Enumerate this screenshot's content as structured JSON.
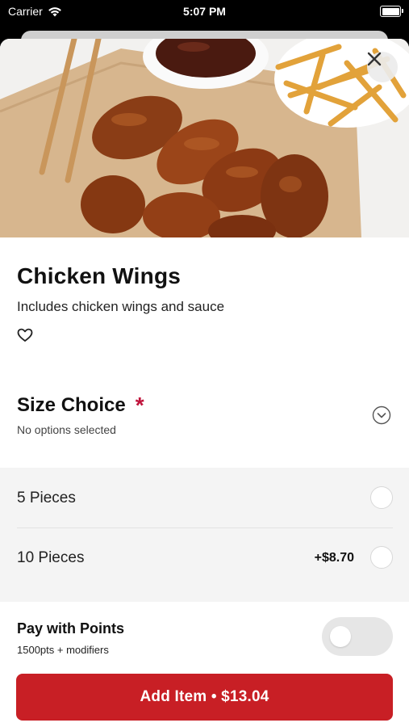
{
  "status_bar": {
    "carrier": "Carrier",
    "time": "5:07 PM"
  },
  "item": {
    "title": "Chicken Wings",
    "description": "Includes chicken wings and sauce"
  },
  "size_choice": {
    "title": "Size Choice",
    "required_marker": "*",
    "status": "No options selected",
    "options": [
      {
        "label": "5 Pieces",
        "price": ""
      },
      {
        "label": "10 Pieces",
        "price": "+$8.70"
      }
    ]
  },
  "points": {
    "title": "Pay with Points",
    "subtitle": "1500pts + modifiers",
    "enabled": false
  },
  "add_button": {
    "label": "Add Item • $13.04"
  },
  "colors": {
    "accent": "#c81f25",
    "required": "#c0143c"
  }
}
